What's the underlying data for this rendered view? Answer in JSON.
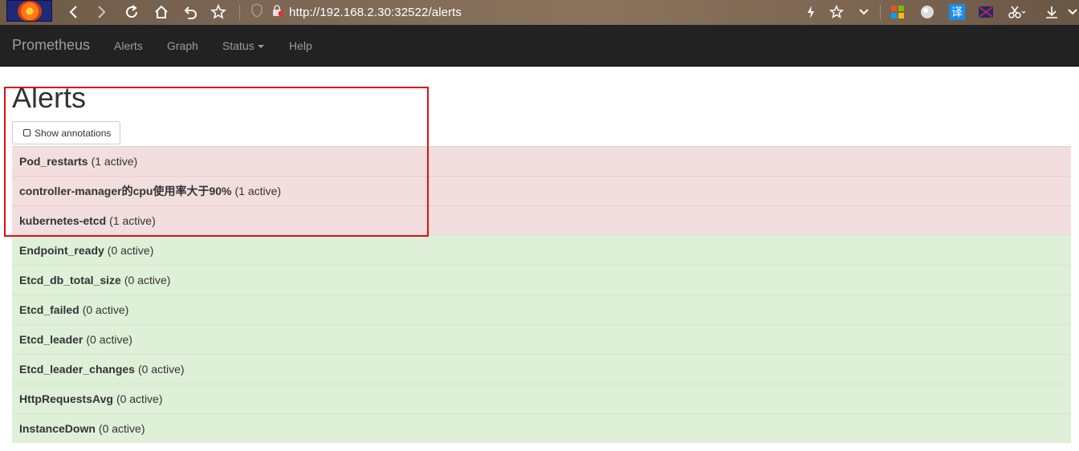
{
  "browser": {
    "url": "http://192.168.2.30:32522/alerts",
    "icons": [
      "back-icon",
      "forward-icon",
      "reload-icon",
      "home-icon",
      "undo-icon",
      "star-icon",
      "shield-icon",
      "lock-icon",
      "lightning-icon",
      "favorite-icon",
      "chevron-down-icon",
      "apps-icon",
      "globe-icon",
      "translate-icon",
      "flag-icon",
      "scissors-icon",
      "download-icon"
    ],
    "translate_glyph": "译"
  },
  "navbar": {
    "brand": "Prometheus",
    "links": [
      "Alerts",
      "Graph",
      "Status",
      "Help"
    ]
  },
  "page": {
    "title": "Alerts",
    "annotations_button": "Show annotations"
  },
  "alerts": [
    {
      "name": "Pod_restarts",
      "count": "(1 active)",
      "state": "firing"
    },
    {
      "name": "controller-manager的cpu使用率大于90%",
      "count": "(1 active)",
      "state": "firing"
    },
    {
      "name": "kubernetes-etcd",
      "count": "(1 active)",
      "state": "firing"
    },
    {
      "name": "Endpoint_ready",
      "count": "(0 active)",
      "state": "inactive"
    },
    {
      "name": "Etcd_db_total_size",
      "count": "(0 active)",
      "state": "inactive"
    },
    {
      "name": "Etcd_failed",
      "count": "(0 active)",
      "state": "inactive"
    },
    {
      "name": "Etcd_leader",
      "count": "(0 active)",
      "state": "inactive"
    },
    {
      "name": "Etcd_leader_changes",
      "count": "(0 active)",
      "state": "inactive"
    },
    {
      "name": "HttpRequestsAvg",
      "count": "(0 active)",
      "state": "inactive"
    },
    {
      "name": "InstanceDown",
      "count": "(0 active)",
      "state": "inactive"
    }
  ],
  "colors": {
    "firing_bg": "#f2dede",
    "inactive_bg": "#dff0d8",
    "navbar_bg": "#222222",
    "highlight": "#e01010"
  }
}
